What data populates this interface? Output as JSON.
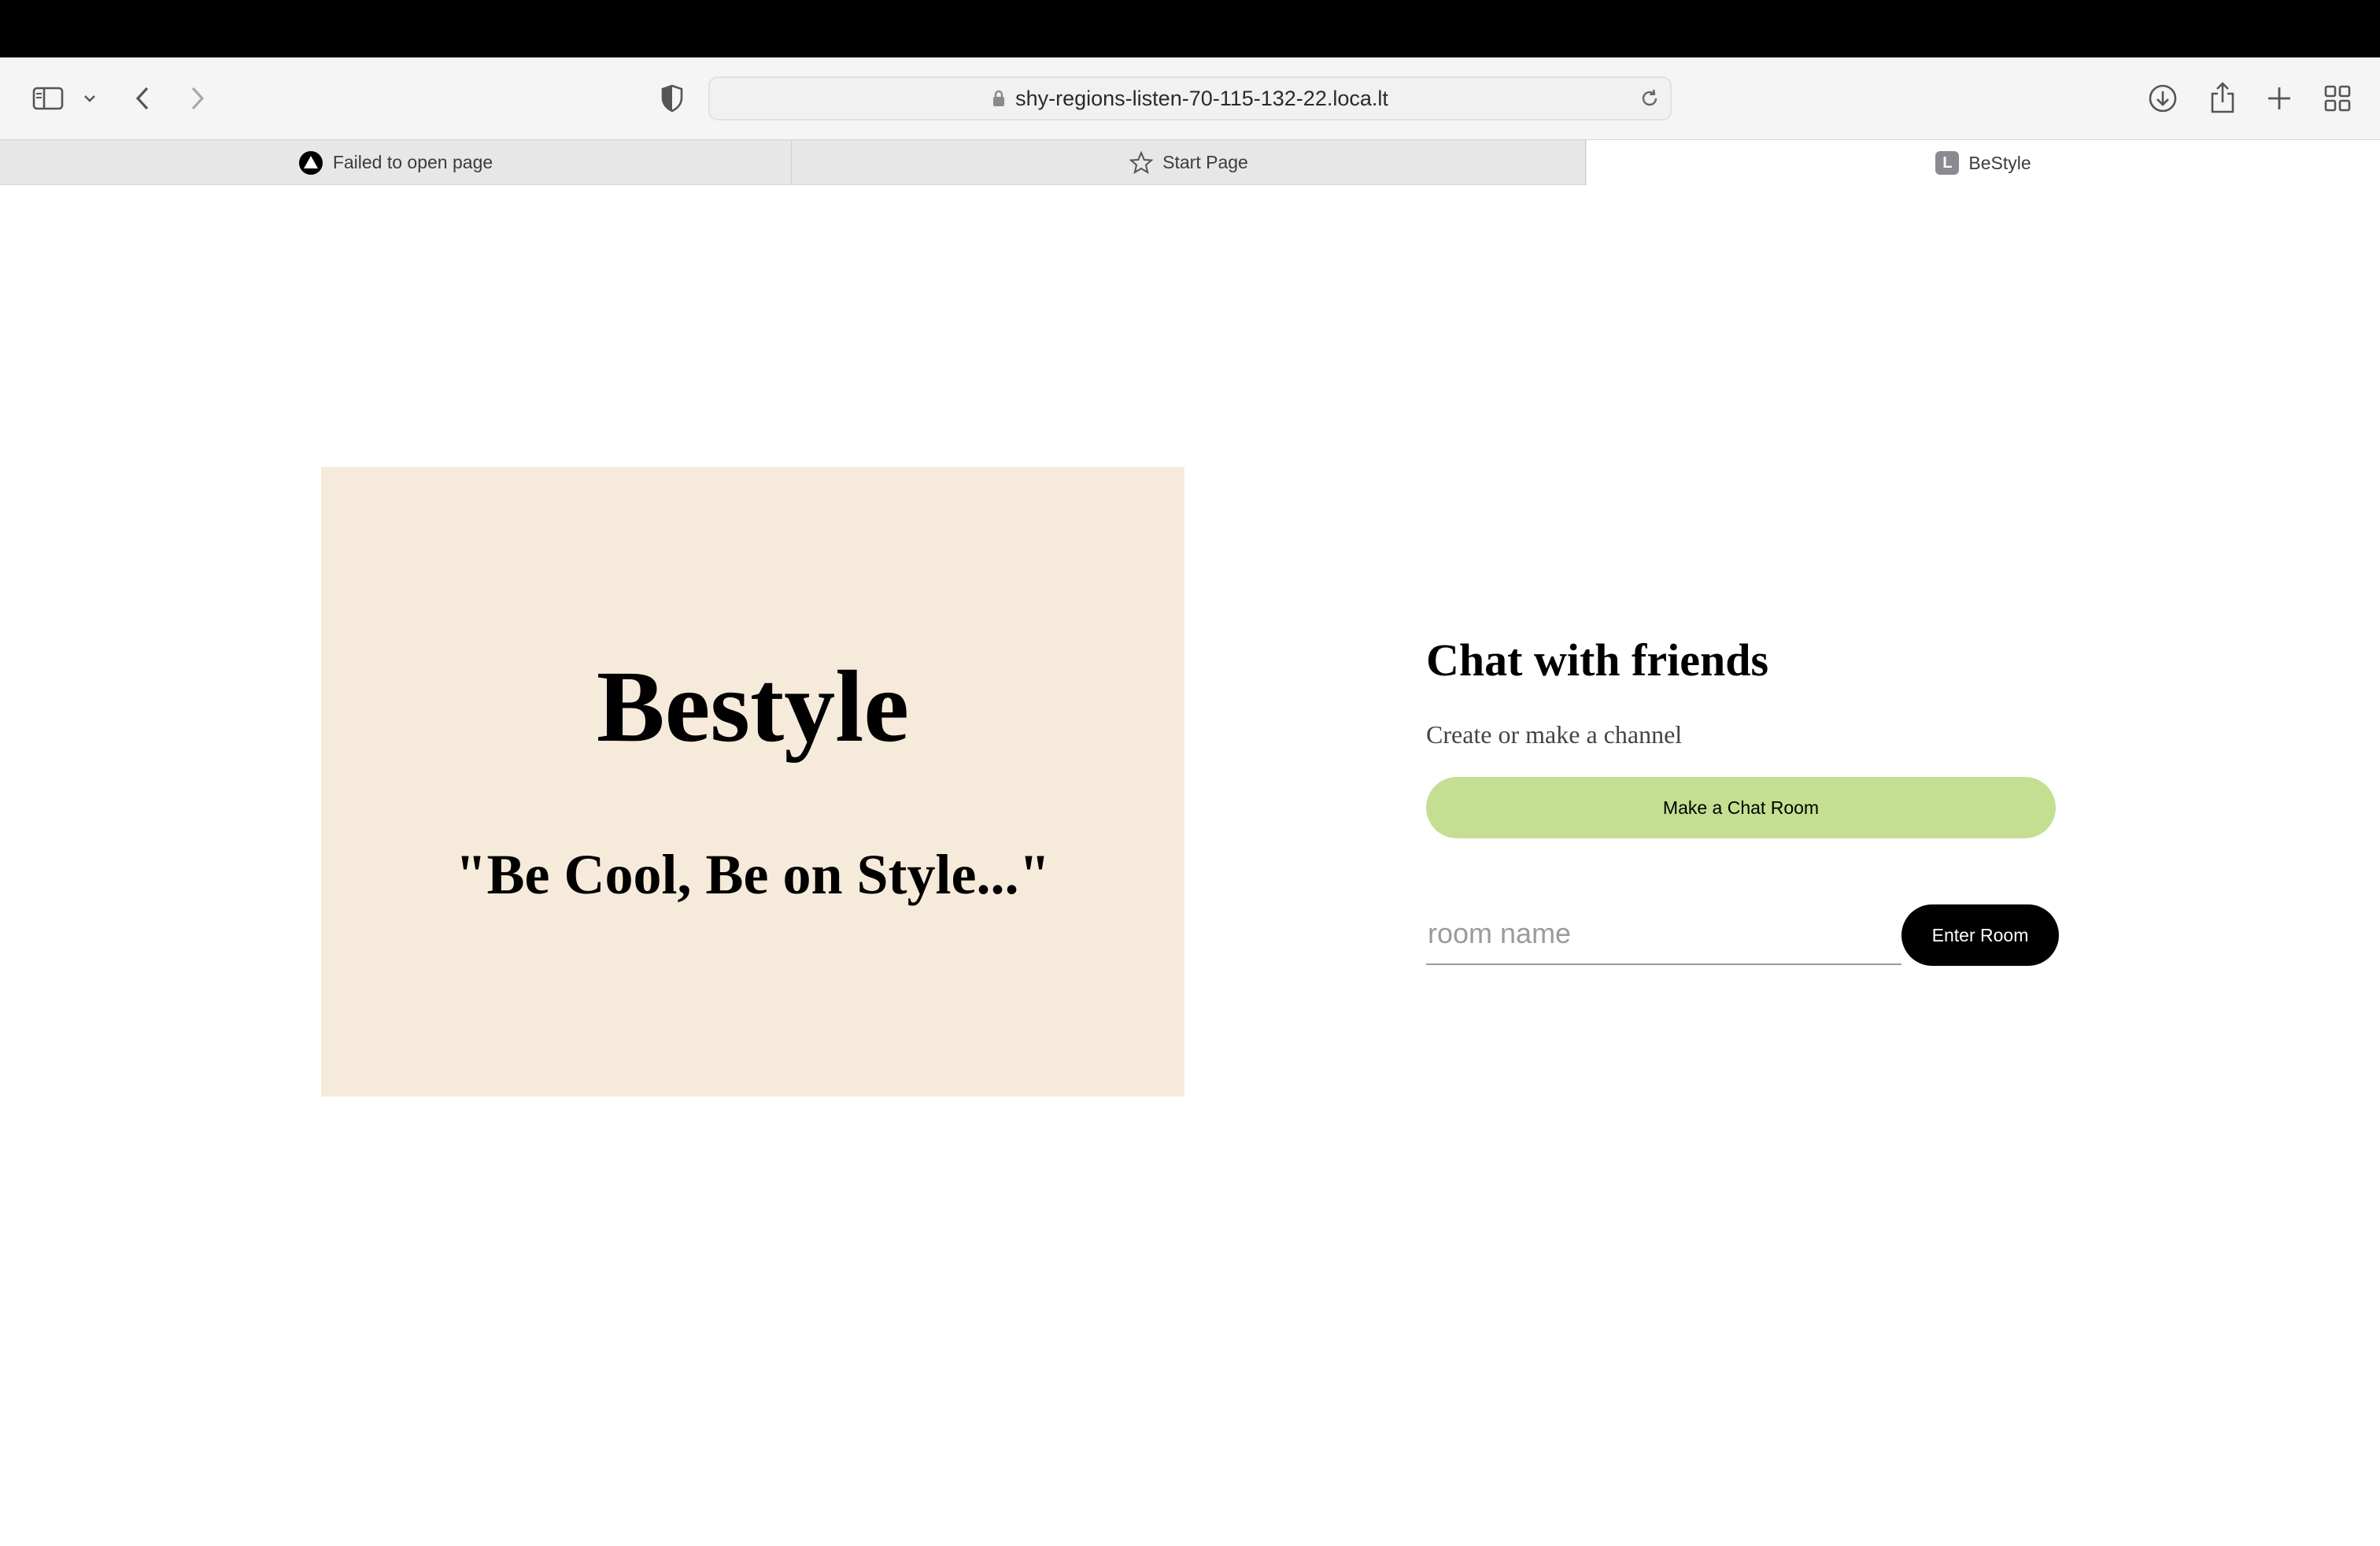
{
  "browser": {
    "url": "shy-regions-listen-70-115-132-22.loca.lt",
    "icons": {
      "sidebar": "sidebar-icon",
      "sidebar_menu": "chevron-down-icon",
      "back": "chevron-left-icon",
      "forward": "chevron-right-icon",
      "privacy": "shield-icon",
      "lock": "lock-icon",
      "reload": "reload-icon",
      "downloads": "download-icon",
      "share": "share-icon",
      "new_tab": "plus-icon",
      "tab_overview": "grid-icon"
    }
  },
  "tabs": [
    {
      "label": "Failed to open page",
      "icon": "warning-triangle-icon",
      "active": false
    },
    {
      "label": "Start Page",
      "icon": "star-icon",
      "active": false
    },
    {
      "label": "BeStyle",
      "icon": "L",
      "active": true
    }
  ],
  "hero": {
    "title": "Bestyle",
    "slogan": "\"Be Cool, Be on Style...\"",
    "background": "#f6ebdb"
  },
  "panel": {
    "title": "Chat with friends",
    "subtitle": "Create or make a channel",
    "make_button": "Make a Chat Room",
    "room_input_value": "",
    "room_input_placeholder": "room name",
    "enter_button": "Enter Room",
    "colors": {
      "make_button": "#c4df91",
      "enter_button": "#000000"
    }
  }
}
